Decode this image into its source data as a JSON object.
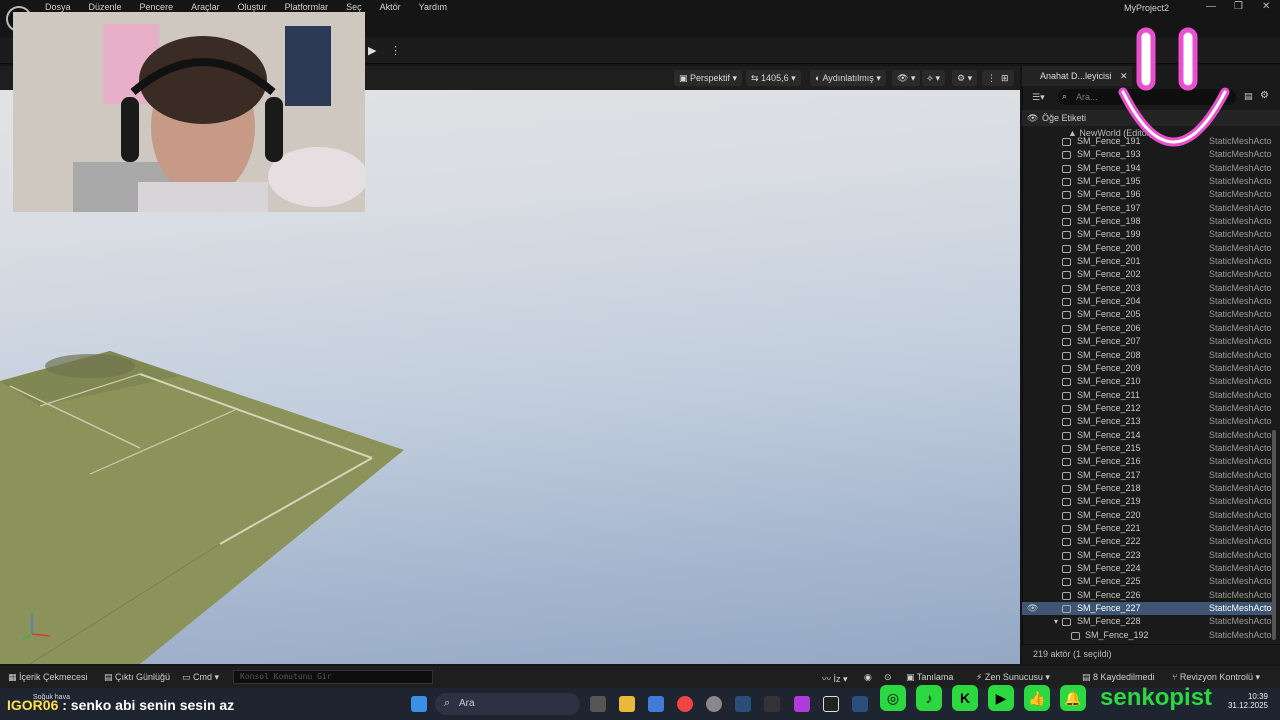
{
  "menu": [
    "Dosya",
    "Düzenle",
    "Pencere",
    "Araçlar",
    "Oluştur",
    "Platformlar",
    "Seç",
    "Aktör",
    "Yardım"
  ],
  "project_name": "MyProject2",
  "viewport": {
    "perspective": "Perspektif",
    "speed": "1405,6",
    "lit": "Aydınlatılmış"
  },
  "outliner": {
    "tab_label": "Anahat D...leyicisi",
    "search_placeholder": "Ara...",
    "header_label": "Öğe Etiketi",
    "world_label": "NewWorld (Editor)",
    "type_label": "StaticMeshActor",
    "type_label_short": "StaticMeshActo",
    "rows": [
      {
        "label": "SM_Fence_191"
      },
      {
        "label": "SM_Fence_193"
      },
      {
        "label": "SM_Fence_194"
      },
      {
        "label": "SM_Fence_195"
      },
      {
        "label": "SM_Fence_196"
      },
      {
        "label": "SM_Fence_197"
      },
      {
        "label": "SM_Fence_198"
      },
      {
        "label": "SM_Fence_199"
      },
      {
        "label": "SM_Fence_200"
      },
      {
        "label": "SM_Fence_201"
      },
      {
        "label": "SM_Fence_202"
      },
      {
        "label": "SM_Fence_203"
      },
      {
        "label": "SM_Fence_204"
      },
      {
        "label": "SM_Fence_205"
      },
      {
        "label": "SM_Fence_206"
      },
      {
        "label": "SM_Fence_207"
      },
      {
        "label": "SM_Fence_208"
      },
      {
        "label": "SM_Fence_209"
      },
      {
        "label": "SM_Fence_210"
      },
      {
        "label": "SM_Fence_211"
      },
      {
        "label": "SM_Fence_212"
      },
      {
        "label": "SM_Fence_213"
      },
      {
        "label": "SM_Fence_214"
      },
      {
        "label": "SM_Fence_215"
      },
      {
        "label": "SM_Fence_216"
      },
      {
        "label": "SM_Fence_217"
      },
      {
        "label": "SM_Fence_218"
      },
      {
        "label": "SM_Fence_219"
      },
      {
        "label": "SM_Fence_220"
      },
      {
        "label": "SM_Fence_221"
      },
      {
        "label": "SM_Fence_222"
      },
      {
        "label": "SM_Fence_223"
      },
      {
        "label": "SM_Fence_224"
      },
      {
        "label": "SM_Fence_225"
      },
      {
        "label": "SM_Fence_226"
      },
      {
        "label": "SM_Fence_227",
        "selected": true
      },
      {
        "label": "SM_Fence_228"
      },
      {
        "label": "SM_Fence_192",
        "child": true
      }
    ],
    "footer": "219 aktör (1 seçildi)"
  },
  "statusbar": {
    "content_drawer": "İçerik Çekmecesi",
    "output_log": "Çıktı Günlüğü",
    "cmd": "Cmd",
    "console_placeholder": "Konsol Komutunu Gir",
    "trace": "İz",
    "derived_data": "Tanılama",
    "zen": "Zen Sunucusu",
    "unsaved": "8 Kaydedilmedi",
    "revision": "Revizyon Kontrolü"
  },
  "chat": {
    "small": "Soğuk hava",
    "user": "IGOR06",
    "message": " : senko abi senin sesin az"
  },
  "taskbar": {
    "search_label": "Ara",
    "time": "10:39",
    "date": "31.12.2025"
  },
  "overlay": {
    "channel": "senkopist",
    "accent": "#2bd83f",
    "smiley_color": "#e94fd0"
  },
  "colors": {
    "selection": "#3e5574",
    "ground": "#8b925a"
  }
}
